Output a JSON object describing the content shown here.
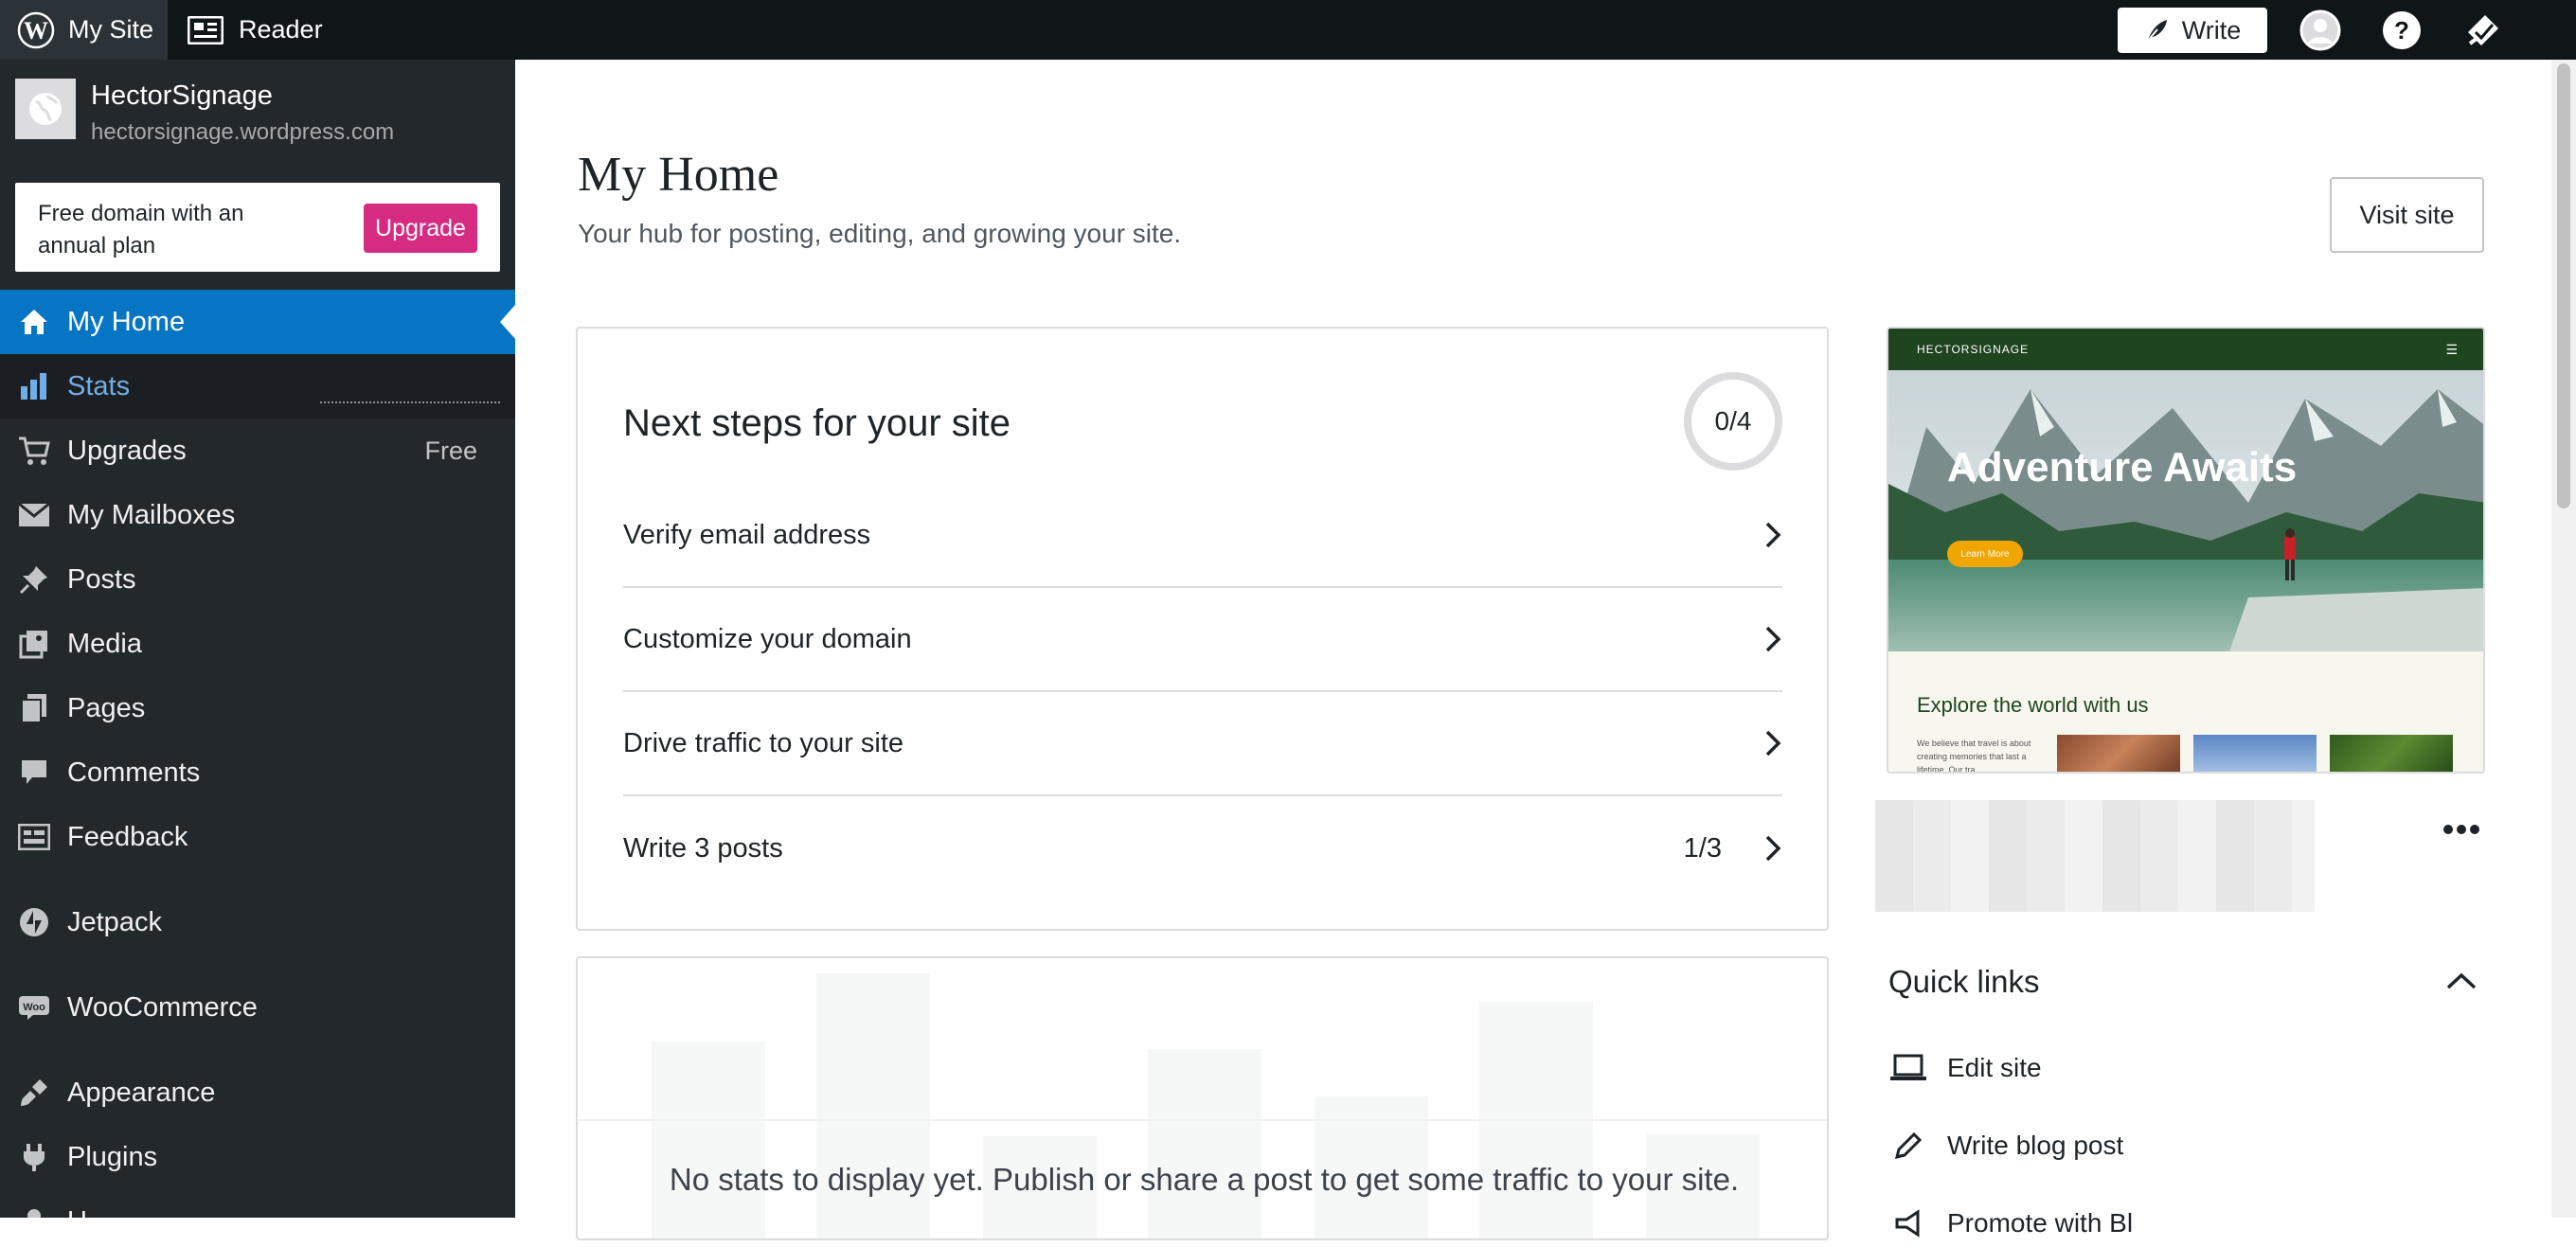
{
  "topbar": {
    "my_site": "My Site",
    "reader": "Reader",
    "write": "Write"
  },
  "site": {
    "name": "HectorSignage",
    "url": "hectorsignage.wordpress.com"
  },
  "promo": {
    "text": "Free domain with an annual plan",
    "button": "Upgrade"
  },
  "sidebar": {
    "items": [
      {
        "label": "My Home",
        "icon": "home-icon"
      },
      {
        "label": "Stats",
        "icon": "stats-icon"
      },
      {
        "label": "Upgrades",
        "icon": "cart-icon",
        "extra": "Free"
      },
      {
        "label": "My Mailboxes",
        "icon": "mail-icon"
      },
      {
        "label": "Posts",
        "icon": "pin-icon"
      },
      {
        "label": "Media",
        "icon": "media-icon"
      },
      {
        "label": "Pages",
        "icon": "pages-icon"
      },
      {
        "label": "Comments",
        "icon": "comment-icon"
      },
      {
        "label": "Feedback",
        "icon": "feedback-icon"
      },
      {
        "label": "Jetpack",
        "icon": "jetpack-icon"
      },
      {
        "label": "WooCommerce",
        "icon": "woo-icon"
      },
      {
        "label": "Appearance",
        "icon": "brush-icon"
      },
      {
        "label": "Plugins",
        "icon": "plugin-icon"
      },
      {
        "label": "U",
        "icon": "users-icon"
      }
    ]
  },
  "main": {
    "title": "My Home",
    "subtitle": "Your hub for posting, editing, and growing your site.",
    "visit_site": "Visit site"
  },
  "next_steps": {
    "title": "Next steps for your site",
    "progress": "0/4",
    "tasks": [
      {
        "label": "Verify email address",
        "count": ""
      },
      {
        "label": "Customize your domain",
        "count": ""
      },
      {
        "label": "Drive traffic to your site",
        "count": ""
      },
      {
        "label": "Write 3 posts",
        "count": "1/3"
      }
    ]
  },
  "stats": {
    "empty_message": "No stats to display yet. Publish or share a post to get some traffic to your site."
  },
  "preview": {
    "brand": "HECTORSIGNAGE",
    "hero_title": "Adventure Awaits",
    "hero_button": "Learn More",
    "section_title": "Explore the world with us",
    "section_text": "We believe that travel is about creating memories that last a lifetime. Our tra"
  },
  "quick_links": {
    "title": "Quick links",
    "items": [
      {
        "label": "Edit site",
        "icon": "laptop-icon"
      },
      {
        "label": "Write blog post",
        "icon": "pencil-icon"
      },
      {
        "label": "Promote with Bl",
        "icon": "megaphone-icon"
      }
    ]
  },
  "colors": {
    "topbar": "#101517",
    "sidebar": "#23282d",
    "active": "#0675c4",
    "upgrade": "#d52c82"
  }
}
